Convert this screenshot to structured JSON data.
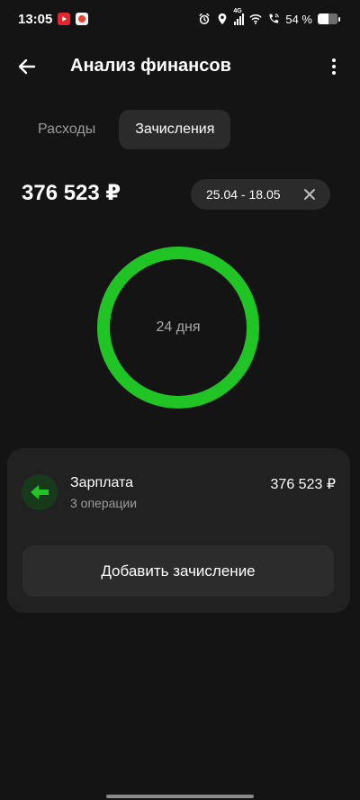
{
  "status_bar": {
    "time": "13:05",
    "network": "4G",
    "battery_text": "54 %",
    "battery_level": 0.54,
    "icons": [
      "youtube-app-icon",
      "app-notification-icon",
      "alarm-icon",
      "location-icon",
      "cellular-signal-icon",
      "wifi-icon",
      "call-icon",
      "battery-icon"
    ]
  },
  "header": {
    "title": "Анализ финансов",
    "back_icon": "arrow-left-icon",
    "menu_icon": "more-vertical-icon"
  },
  "tabs": [
    {
      "label": "Расходы",
      "active": false
    },
    {
      "label": "Зачисления",
      "active": true
    }
  ],
  "summary": {
    "amount": "376 523 ₽",
    "date_range": "25.04 - 18.05",
    "clear_icon": "close-icon"
  },
  "ring": {
    "label": "24 дня",
    "fraction": 1.0,
    "color": "#21c425",
    "track_color": "#1e1e1e"
  },
  "income_list": [
    {
      "title": "Зарплата",
      "subtitle": "3 операции",
      "amount": "376 523 ₽",
      "icon": "arrow-left-icon",
      "icon_color": "#21c425"
    }
  ],
  "add_button": {
    "label": "Добавить зачисление"
  },
  "colors": {
    "background": "#141414",
    "card": "#212121",
    "chip": "#2b2b2b",
    "accent_green": "#21c425"
  }
}
